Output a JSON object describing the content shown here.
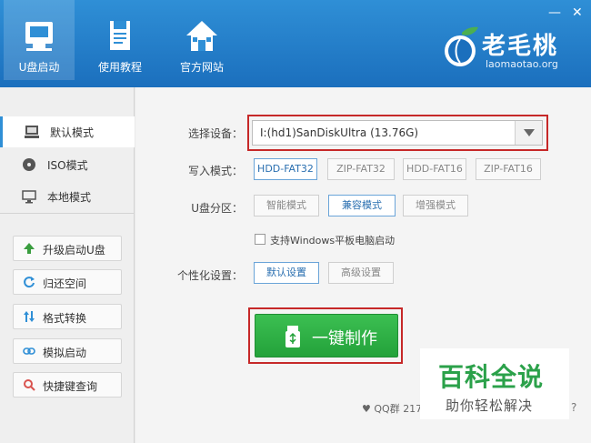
{
  "header": {
    "nav": [
      {
        "label": "U盘启动",
        "icon": "usb-drive-icon",
        "active": true
      },
      {
        "label": "使用教程",
        "icon": "document-icon",
        "active": false
      },
      {
        "label": "官方网站",
        "icon": "home-icon",
        "active": false
      }
    ],
    "brand": {
      "name": "老毛桃",
      "domain": "laomaotao.org"
    },
    "window": {
      "minimize": "—",
      "close": "✕"
    }
  },
  "sidebar": {
    "modes": [
      {
        "label": "默认模式",
        "icon": "computer-icon",
        "active": true
      },
      {
        "label": "ISO模式",
        "icon": "disc-icon",
        "active": false
      },
      {
        "label": "本地模式",
        "icon": "monitor-icon",
        "active": false
      }
    ],
    "tools": [
      {
        "label": "升级启动U盘",
        "icon": "arrow-up-icon"
      },
      {
        "label": "归还空间",
        "icon": "restore-icon"
      },
      {
        "label": "格式转换",
        "icon": "convert-icon"
      },
      {
        "label": "模拟启动",
        "icon": "link-icon"
      },
      {
        "label": "快捷键查询",
        "icon": "search-icon"
      }
    ]
  },
  "main": {
    "device_label": "选择设备：",
    "device_value": "I:(hd1)SanDiskUltra (13.76G)",
    "write_label": "写入模式：",
    "write_options": [
      "HDD-FAT32",
      "ZIP-FAT32",
      "HDD-FAT16",
      "ZIP-FAT16"
    ],
    "write_selected": 0,
    "partition_label": "U盘分区：",
    "partition_options": [
      "智能模式",
      "兼容模式",
      "增强模式"
    ],
    "partition_selected": 1,
    "checkbox_label": "支持Windows平板电脑启动",
    "checkbox_checked": false,
    "custom_label": "个性化设置：",
    "custom_options": [
      "默认设置",
      "高级设置"
    ],
    "custom_selected": 0,
    "burn_label": "一键制作",
    "qq_text": "QQ群 217"
  },
  "watermark": {
    "line1": "百科全说",
    "line2": "助你轻松解决",
    "fragment": "?"
  },
  "colors": {
    "header": "#1b6fbd",
    "accent": "#2f8fd6",
    "burn": "#23a23a",
    "highlight": "#c62828",
    "watermark": "#2ba14a"
  }
}
